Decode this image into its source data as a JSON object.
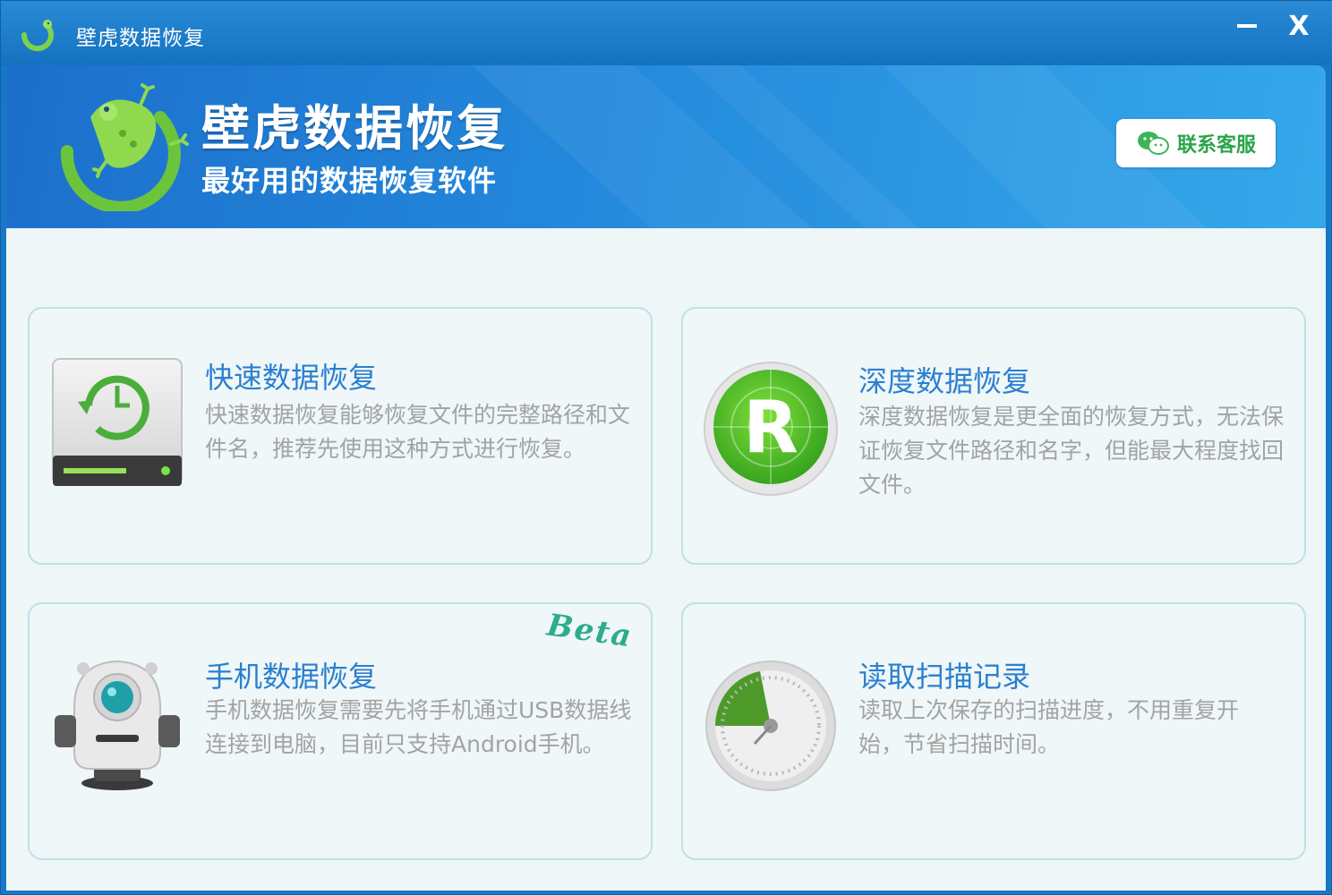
{
  "window": {
    "title": "壁虎数据恢复",
    "minimize_icon": "minimize-icon",
    "close_label": "X"
  },
  "banner": {
    "title": "壁虎数据恢复",
    "subtitle": "最好用的数据恢复软件",
    "contact_label": "联系客服",
    "contact_icon": "wechat-icon"
  },
  "cards": [
    {
      "title": "快速数据恢复",
      "description": "快速数据恢复能够恢复文件的完整路径和文件名，推荐先使用这种方式进行恢复。",
      "icon": "hard-drive-restore-icon"
    },
    {
      "title": "深度数据恢复",
      "description": "深度数据恢复是更全面的恢复方式，无法保证恢复文件路径和名字，但能最大程度找回文件。",
      "icon": "radar-r-icon"
    },
    {
      "title": "手机数据恢复",
      "description": "手机数据恢复需要先将手机通过USB数据线连接到电脑，目前只支持Android手机。",
      "icon": "robot-phone-icon",
      "badge": "Beta"
    },
    {
      "title": "读取扫描记录",
      "description": "读取上次保存的扫描进度，不用重复开始，节省扫描时间。",
      "icon": "scan-gauge-icon"
    }
  ],
  "colors": {
    "titlebar": "#1778c6",
    "card_title": "#2b7fd0",
    "card_desc": "#a3a3a3",
    "contact_text": "#2aa54a",
    "beta": "#2dac8e"
  }
}
